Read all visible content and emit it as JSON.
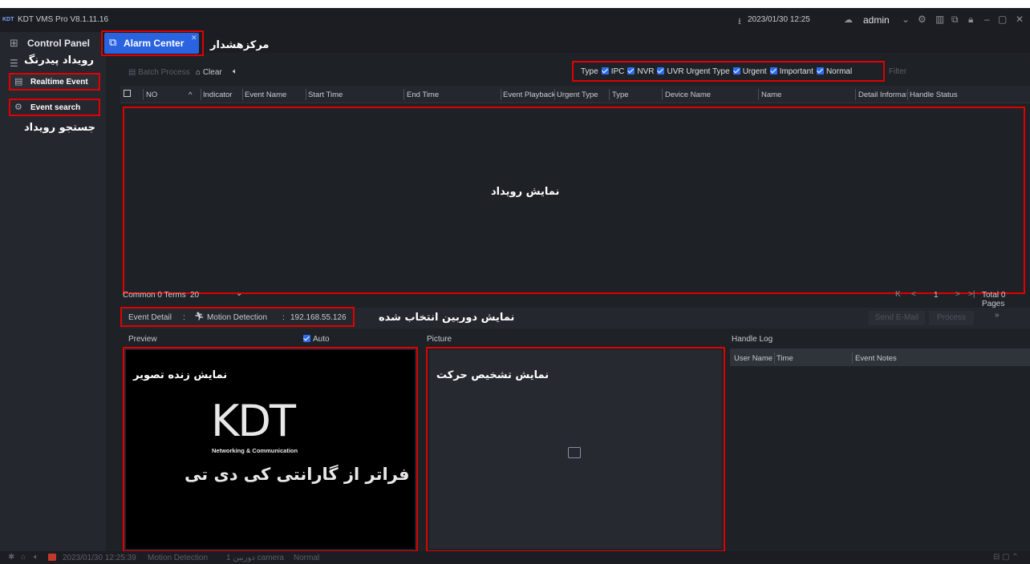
{
  "window": {
    "title": "KDT VMS Pro V8.1.11.16",
    "datetime": "2023/01/30 12:25",
    "user": "admin"
  },
  "sidebar": {
    "control_panel": "Control Panel",
    "section_title_fa": "رویداد پیدرنگ",
    "items": [
      {
        "label": "Realtime Event"
      },
      {
        "label": "Event search"
      }
    ],
    "event_search_annotation_fa": "جستجو رویداد"
  },
  "tabs": {
    "active": "Alarm Center",
    "active_annotation_fa": "مرکزهشدار"
  },
  "toolbar": {
    "batch_process": "Batch Process",
    "clear": "Clear"
  },
  "filters": {
    "type_label": "Type",
    "type_options": [
      "IPC",
      "NVR",
      "UVR"
    ],
    "urgent_type_label": "Urgent Type",
    "urgent_options": [
      "Urgent",
      "Important",
      "Normal"
    ],
    "filter_placeholder": "Filter"
  },
  "table": {
    "columns": [
      "NO",
      "Indicator",
      "Event Name",
      "Start Time",
      "End Time",
      "Event Playback",
      "Urgent Type",
      "Type",
      "Device Name",
      "Name",
      "Detail Informati",
      "Handle Status"
    ],
    "empty_annotation_fa": "نمایش رویداد"
  },
  "pager": {
    "common_terms": "Common 0 Terms",
    "page_size": "20",
    "current_page": "1",
    "total": "Total 0 Pages"
  },
  "event_detail": {
    "label": "Event Detail",
    "event": "Motion Detection",
    "ip": "192.168.55.126",
    "annotation_fa": "نمایش دوربین انتخاب شده",
    "send_email": "Send E-Mail",
    "process": "Process"
  },
  "preview": {
    "label": "Preview",
    "auto": "Auto",
    "annotation_fa": "نمایش زنده تصویر",
    "logo_text": "KDT",
    "logo_subtitle": "Networking & Communication",
    "logo_slogan_fa": "فراتر از گارانتی کی دی تی"
  },
  "picture": {
    "label": "Picture",
    "annotation_fa": "نمایش تشخیص حرکت"
  },
  "handle_log": {
    "label": "Handle Log",
    "columns": [
      "User Name",
      "Time",
      "Event Notes"
    ]
  },
  "statusbar": {
    "datetime": "2023/01/30 12:25:39",
    "event": "Motion Detection",
    "channel": "1 دوربین camera",
    "level": "Normal"
  }
}
